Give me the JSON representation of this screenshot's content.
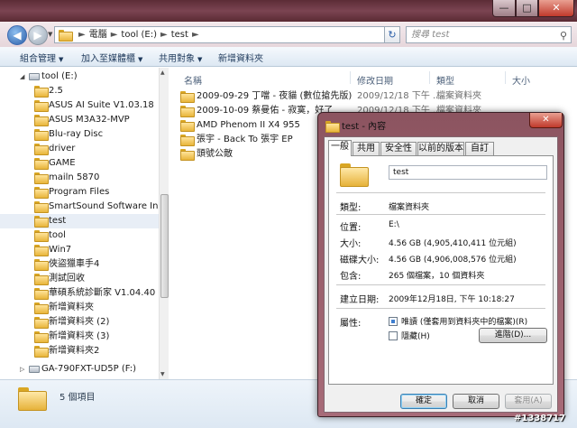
{
  "address": {
    "crumbs": [
      "電腦",
      "tool (E:)",
      "test"
    ],
    "search_placeholder": "搜尋 test"
  },
  "toolbar": {
    "organize": "組合管理",
    "add_library": "加入至媒體櫃",
    "share": "共用對象",
    "new_folder": "新增資料夾"
  },
  "nav": {
    "drive_top": "tool (E:)",
    "items": [
      "2.5",
      "ASUS AI Suite V1.03.18",
      "ASUS M3A32-MVP",
      "Blu-ray Disc",
      "driver",
      "GAME",
      "mailn 5870",
      "Program Files",
      "SmartSound Software Inc",
      "test",
      "tool",
      "Win7",
      "俠盜獵車手4",
      "測試回收",
      "華碩系統診斷家 V1.04.40",
      "新增資料夾",
      "新增資料夾 (2)",
      "新增資料夾 (3)",
      "新增資料夾2"
    ],
    "drive_bottom": "GA-790FXT-UD5P (F:)"
  },
  "columns": {
    "name": "名稱",
    "date": "修改日期",
    "type": "類型",
    "size": "大小"
  },
  "files": [
    {
      "name": "2009-09-29 丁噹 - 夜貓 (數位搶先版)",
      "date": "2009/12/18 下午 ...",
      "type": "檔案資料夾"
    },
    {
      "name": "2009-10-09 蔡曼佑 - 寂寞，好了",
      "date": "2009/12/18 下午 ...",
      "type": "檔案資料夾"
    },
    {
      "name": "AMD Phenom II X4 955",
      "date": "",
      "type": ""
    },
    {
      "name": "張宇 - Back To 張宇 EP",
      "date": "",
      "type": ""
    },
    {
      "name": "頭號公敵",
      "date": "",
      "type": ""
    }
  ],
  "status": {
    "count": "5 個項目"
  },
  "dialog": {
    "title": "test - 內容",
    "tabs": [
      "一般",
      "共用",
      "安全性",
      "以前的版本",
      "自訂"
    ],
    "folder_name": "test",
    "type_label": "類型:",
    "type_value": "檔案資料夾",
    "location_label": "位置:",
    "location_value": "E:\\",
    "size_label": "大小:",
    "size_value": "4.56 GB (4,905,410,411 位元組)",
    "disk_size_label": "磁碟大小:",
    "disk_size_value": "4.56 GB (4,906,008,576 位元組)",
    "contains_label": "包含:",
    "contains_value": "265 個檔案，10 個資料夾",
    "created_label": "建立日期:",
    "created_value": "2009年12月18日, 下午 10:18:27",
    "attributes_label": "屬性:",
    "readonly_label": "唯讀 (僅套用到資料夾中的檔案)(R)",
    "hidden_label": "隱藏(H)",
    "advanced_button": "進階(D)...",
    "ok_button": "確定",
    "cancel_button": "取消",
    "apply_button": "套用(A)"
  },
  "watermark": "#1338717"
}
